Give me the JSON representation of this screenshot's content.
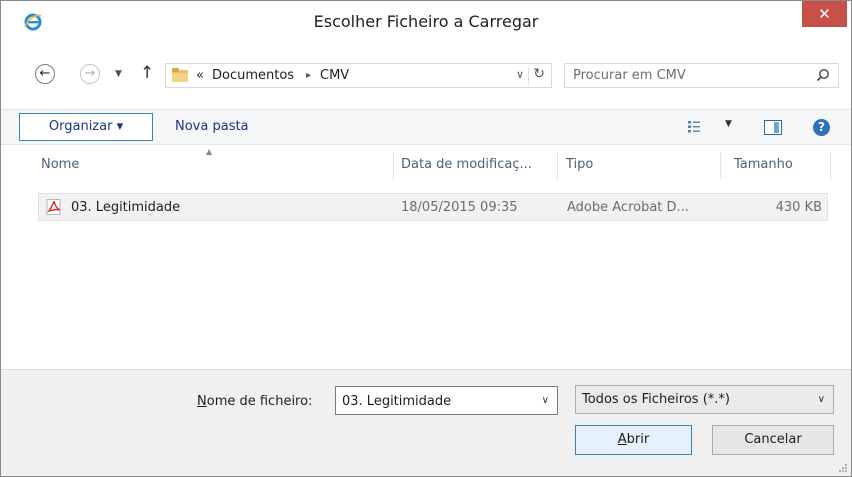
{
  "window": {
    "title": "Escolher Ficheiro a Carregar",
    "close_label": "✕"
  },
  "nav": {
    "back_icon": "←",
    "forward_icon": "→",
    "recent_icon": "▼",
    "up_icon": "↑",
    "breadcrumb": [
      "«",
      "Documentos",
      "▸",
      "CMV"
    ],
    "address_dropdown_icon": "∨",
    "refresh_icon": "↻"
  },
  "search": {
    "placeholder": "Procurar em CMV"
  },
  "toolbar": {
    "organize_label": "Organizar ▾",
    "new_folder_label": "Nova pasta",
    "view_dropdown": "▼",
    "help_label": "?"
  },
  "columns": {
    "sort_arrow": "▲",
    "name": "Nome",
    "modified": "Data de modificaç...",
    "type": "Tipo",
    "size": "Tamanho"
  },
  "files": [
    {
      "name": "03. Legitimidade",
      "modified": "18/05/2015 09:35",
      "type": "Adobe Acrobat D...",
      "size": "430 KB"
    }
  ],
  "footer": {
    "filename_label_mnemonic": "N",
    "filename_label_rest": "ome de ficheiro:",
    "filename_value": "03. Legitimidade",
    "filename_dropdown": "∨",
    "filetype_value": "Todos os Ficheiros (*.*)",
    "filetype_dropdown": "∨",
    "open_mnemonic": "A",
    "open_rest": "brir",
    "cancel_label": "Cancelar"
  },
  "colors": {
    "close_bg": "#c7504b",
    "link_blue": "#1e3287",
    "focus_border": "#3c7fb1"
  }
}
